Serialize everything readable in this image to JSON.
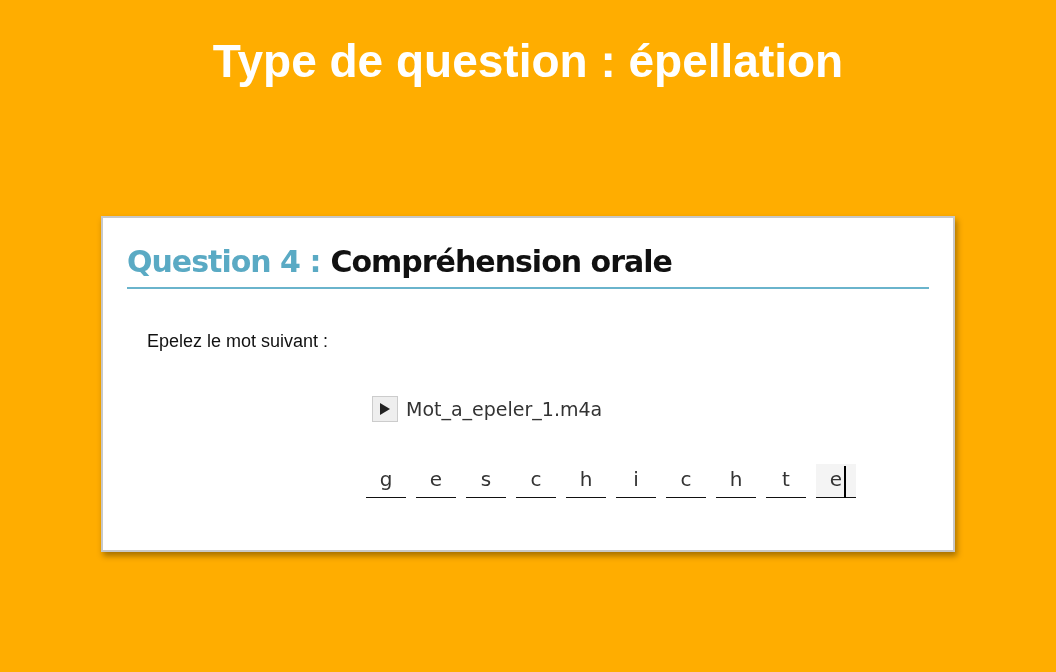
{
  "slide_title": "Type de question : épellation",
  "question": {
    "number_label": "Question 4 :",
    "title": "Compréhension orale",
    "prompt": "Epelez le mot suivant :",
    "audio": {
      "filename": "Mot_a_epeler_1.m4a"
    },
    "letters": [
      {
        "value": "g",
        "focused": false
      },
      {
        "value": "e",
        "focused": false
      },
      {
        "value": "s",
        "focused": false
      },
      {
        "value": "c",
        "focused": false
      },
      {
        "value": "h",
        "focused": false
      },
      {
        "value": "i",
        "focused": false
      },
      {
        "value": "c",
        "focused": false
      },
      {
        "value": "h",
        "focused": false
      },
      {
        "value": "t",
        "focused": false
      },
      {
        "value": "e",
        "focused": true
      }
    ]
  }
}
